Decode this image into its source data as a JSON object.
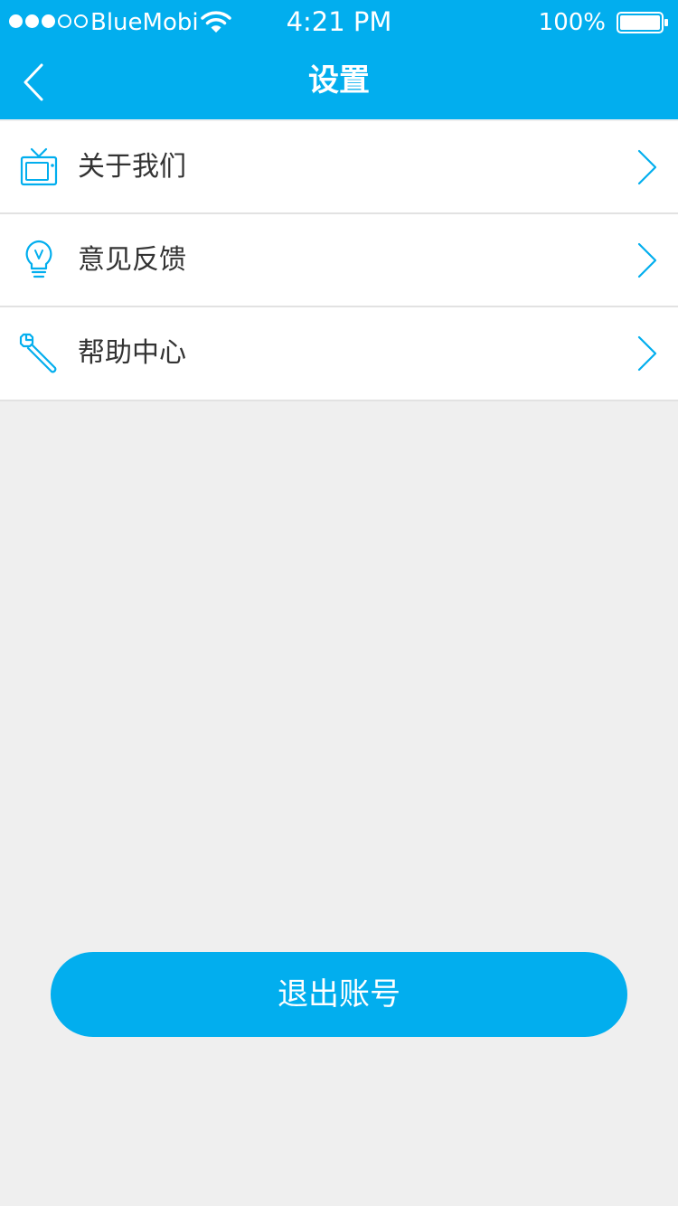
{
  "status_bar": {
    "carrier": "BlueMobi",
    "time": "4:21 PM",
    "battery": "100%",
    "signal_icon": "signal-dots-icon",
    "wifi_icon": "wifi-icon",
    "battery_icon": "battery-icon"
  },
  "nav": {
    "title": "设置",
    "back_icon": "chevron-left-icon"
  },
  "menu": {
    "items": [
      {
        "label": "关于我们",
        "icon": "tv-icon"
      },
      {
        "label": "意见反馈",
        "icon": "lightbulb-icon"
      },
      {
        "label": "帮助中心",
        "icon": "wrench-icon"
      }
    ],
    "chevron_icon": "chevron-right-icon"
  },
  "logout": {
    "label": "退出账号"
  },
  "colors": {
    "accent": "#02aeee",
    "background": "#efefef",
    "text": "#333333"
  }
}
